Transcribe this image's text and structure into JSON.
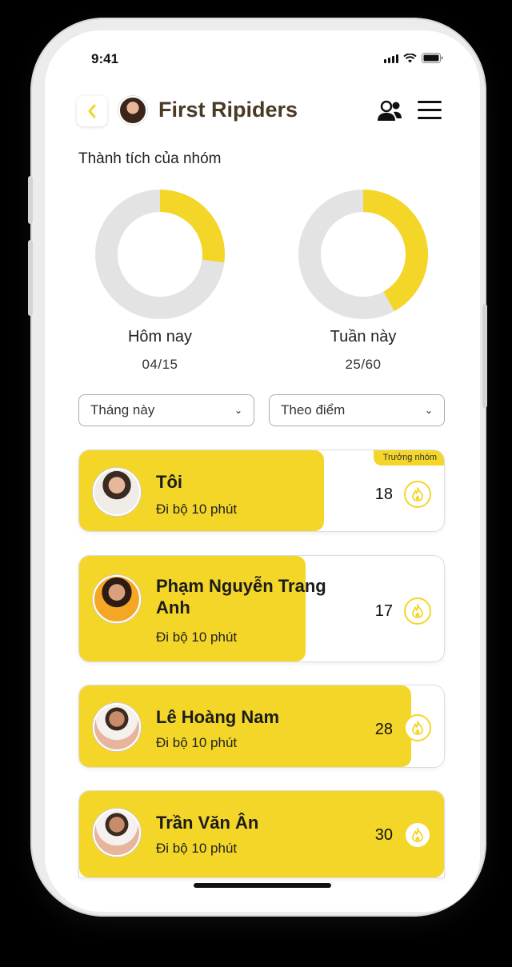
{
  "status": {
    "time": "9:41"
  },
  "header": {
    "title": "First Ripiders"
  },
  "achievements": {
    "title": "Thành tích của nhóm",
    "today": {
      "label": "Hôm nay",
      "value": "04/15",
      "progress": 0.27
    },
    "week": {
      "label": "Tuần này",
      "value": "25/60",
      "progress": 0.42
    }
  },
  "filters": {
    "period": "Tháng này",
    "sort": "Theo điểm"
  },
  "members": [
    {
      "name": "Tôi",
      "activity": "Đi bộ 10 phút",
      "score": "18",
      "badge": "Trưởng nhóm",
      "progress": 0.67
    },
    {
      "name": "Phạm Nguyễn Trang Anh",
      "activity": "Đi bộ 10 phút",
      "score": "17",
      "progress": 0.62
    },
    {
      "name": "Lê Hoàng Nam",
      "activity": "Đi bộ 10 phút",
      "score": "28",
      "progress": 0.91
    },
    {
      "name": "Trần Văn Ân",
      "activity": "Đi bộ 10 phút",
      "score": "30",
      "progress": 1.0
    }
  ],
  "colors": {
    "accent": "#f3d628",
    "track": "#e3e3e3",
    "title": "#4a3a25"
  }
}
